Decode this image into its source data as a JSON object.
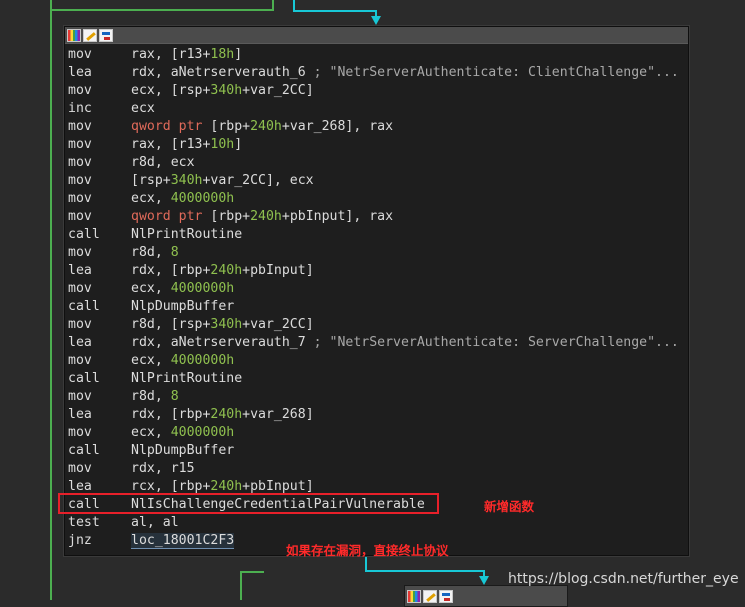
{
  "graph": {
    "node_main": {
      "toolbar_icons": [
        "color-palette-icon",
        "edit-pencil-icon",
        "graph-overview-icon"
      ],
      "lines": [
        {
          "mnemonic": "mov",
          "tokens": [
            {
              "t": "rax, [r13+",
              "c": "reg"
            },
            {
              "t": "18h",
              "c": "num"
            },
            {
              "t": "]",
              "c": "reg"
            }
          ]
        },
        {
          "mnemonic": "lea",
          "tokens": [
            {
              "t": "rdx, aNetrserverauth_6 ",
              "c": "reg"
            },
            {
              "t": "; \"NetrServerAuthenticate: ClientChallenge\"...",
              "c": "cmt"
            }
          ]
        },
        {
          "mnemonic": "mov",
          "tokens": [
            {
              "t": "ecx, [rsp+",
              "c": "reg"
            },
            {
              "t": "340h",
              "c": "num"
            },
            {
              "t": "+var_2CC]",
              "c": "reg"
            }
          ]
        },
        {
          "mnemonic": "inc",
          "tokens": [
            {
              "t": "ecx",
              "c": "reg"
            }
          ]
        },
        {
          "mnemonic": "mov",
          "tokens": [
            {
              "t": "qword ptr",
              "c": "kw"
            },
            {
              "t": " [rbp+",
              "c": "reg"
            },
            {
              "t": "240h",
              "c": "num"
            },
            {
              "t": "+var_268], rax",
              "c": "reg"
            }
          ]
        },
        {
          "mnemonic": "mov",
          "tokens": [
            {
              "t": "rax, [r13+",
              "c": "reg"
            },
            {
              "t": "10h",
              "c": "num"
            },
            {
              "t": "]",
              "c": "reg"
            }
          ]
        },
        {
          "mnemonic": "mov",
          "tokens": [
            {
              "t": "r8d, ecx",
              "c": "reg"
            }
          ]
        },
        {
          "mnemonic": "mov",
          "tokens": [
            {
              "t": "[rsp+",
              "c": "reg"
            },
            {
              "t": "340h",
              "c": "num"
            },
            {
              "t": "+var_2CC], ecx",
              "c": "reg"
            }
          ]
        },
        {
          "mnemonic": "mov",
          "tokens": [
            {
              "t": "ecx, ",
              "c": "reg"
            },
            {
              "t": "4000000h",
              "c": "num"
            }
          ]
        },
        {
          "mnemonic": "mov",
          "tokens": [
            {
              "t": "qword ptr",
              "c": "kw"
            },
            {
              "t": " [rbp+",
              "c": "reg"
            },
            {
              "t": "240h",
              "c": "num"
            },
            {
              "t": "+pbInput], rax",
              "c": "reg"
            }
          ]
        },
        {
          "mnemonic": "call",
          "tokens": [
            {
              "t": "NlPrintRoutine",
              "c": "fn"
            }
          ]
        },
        {
          "mnemonic": "mov",
          "tokens": [
            {
              "t": "r8d, ",
              "c": "reg"
            },
            {
              "t": "8",
              "c": "num"
            }
          ]
        },
        {
          "mnemonic": "lea",
          "tokens": [
            {
              "t": "rdx, [rbp+",
              "c": "reg"
            },
            {
              "t": "240h",
              "c": "num"
            },
            {
              "t": "+pbInput]",
              "c": "reg"
            }
          ]
        },
        {
          "mnemonic": "mov",
          "tokens": [
            {
              "t": "ecx, ",
              "c": "reg"
            },
            {
              "t": "4000000h",
              "c": "num"
            }
          ]
        },
        {
          "mnemonic": "call",
          "tokens": [
            {
              "t": "NlpDumpBuffer",
              "c": "fn"
            }
          ]
        },
        {
          "mnemonic": "mov",
          "tokens": [
            {
              "t": "r8d, [rsp+",
              "c": "reg"
            },
            {
              "t": "340h",
              "c": "num"
            },
            {
              "t": "+var_2CC]",
              "c": "reg"
            }
          ]
        },
        {
          "mnemonic": "lea",
          "tokens": [
            {
              "t": "rdx, aNetrserverauth_7 ",
              "c": "reg"
            },
            {
              "t": "; \"NetrServerAuthenticate: ServerChallenge\"...",
              "c": "cmt"
            }
          ]
        },
        {
          "mnemonic": "mov",
          "tokens": [
            {
              "t": "ecx, ",
              "c": "reg"
            },
            {
              "t": "4000000h",
              "c": "num"
            }
          ]
        },
        {
          "mnemonic": "call",
          "tokens": [
            {
              "t": "NlPrintRoutine",
              "c": "fn"
            }
          ]
        },
        {
          "mnemonic": "mov",
          "tokens": [
            {
              "t": "r8d, ",
              "c": "reg"
            },
            {
              "t": "8",
              "c": "num"
            }
          ]
        },
        {
          "mnemonic": "lea",
          "tokens": [
            {
              "t": "rdx, [rbp+",
              "c": "reg"
            },
            {
              "t": "240h",
              "c": "num"
            },
            {
              "t": "+var_268]",
              "c": "reg"
            }
          ]
        },
        {
          "mnemonic": "mov",
          "tokens": [
            {
              "t": "ecx, ",
              "c": "reg"
            },
            {
              "t": "4000000h",
              "c": "num"
            }
          ]
        },
        {
          "mnemonic": "call",
          "tokens": [
            {
              "t": "NlpDumpBuffer",
              "c": "fn"
            }
          ]
        },
        {
          "mnemonic": "mov",
          "tokens": [
            {
              "t": "rdx, r15",
              "c": "reg"
            }
          ]
        },
        {
          "mnemonic": "lea",
          "tokens": [
            {
              "t": "rcx, [rbp+",
              "c": "reg"
            },
            {
              "t": "240h",
              "c": "num"
            },
            {
              "t": "+pbInput]",
              "c": "reg"
            }
          ]
        },
        {
          "mnemonic": "call",
          "tokens": [
            {
              "t": "NlIsChallengeCredentialPairVulnerable",
              "c": "fn"
            }
          ]
        },
        {
          "mnemonic": "test",
          "tokens": [
            {
              "t": "al, al",
              "c": "reg"
            }
          ]
        },
        {
          "mnemonic": "jnz",
          "tokens": [
            {
              "t": "loc_18001C2F3",
              "c": "loc"
            }
          ]
        }
      ]
    },
    "node_next": {
      "toolbar_icons": [
        "color-palette-icon",
        "edit-pencil-icon",
        "graph-overview-icon"
      ]
    }
  },
  "annotations": {
    "new_function": "新增函数",
    "terminate_note": "如果存在漏洞，直接终止协议"
  },
  "watermark": "https://blog.csdn.net/further_eye",
  "colors": {
    "background": "#2b2b2b",
    "node_bg": "#1e1e1e",
    "number": "#8fc04f",
    "keyword": "#e06a5a",
    "highlight_box": "#e8202a",
    "edge_true": "#4caf50",
    "edge_flow": "#18c8d6"
  }
}
